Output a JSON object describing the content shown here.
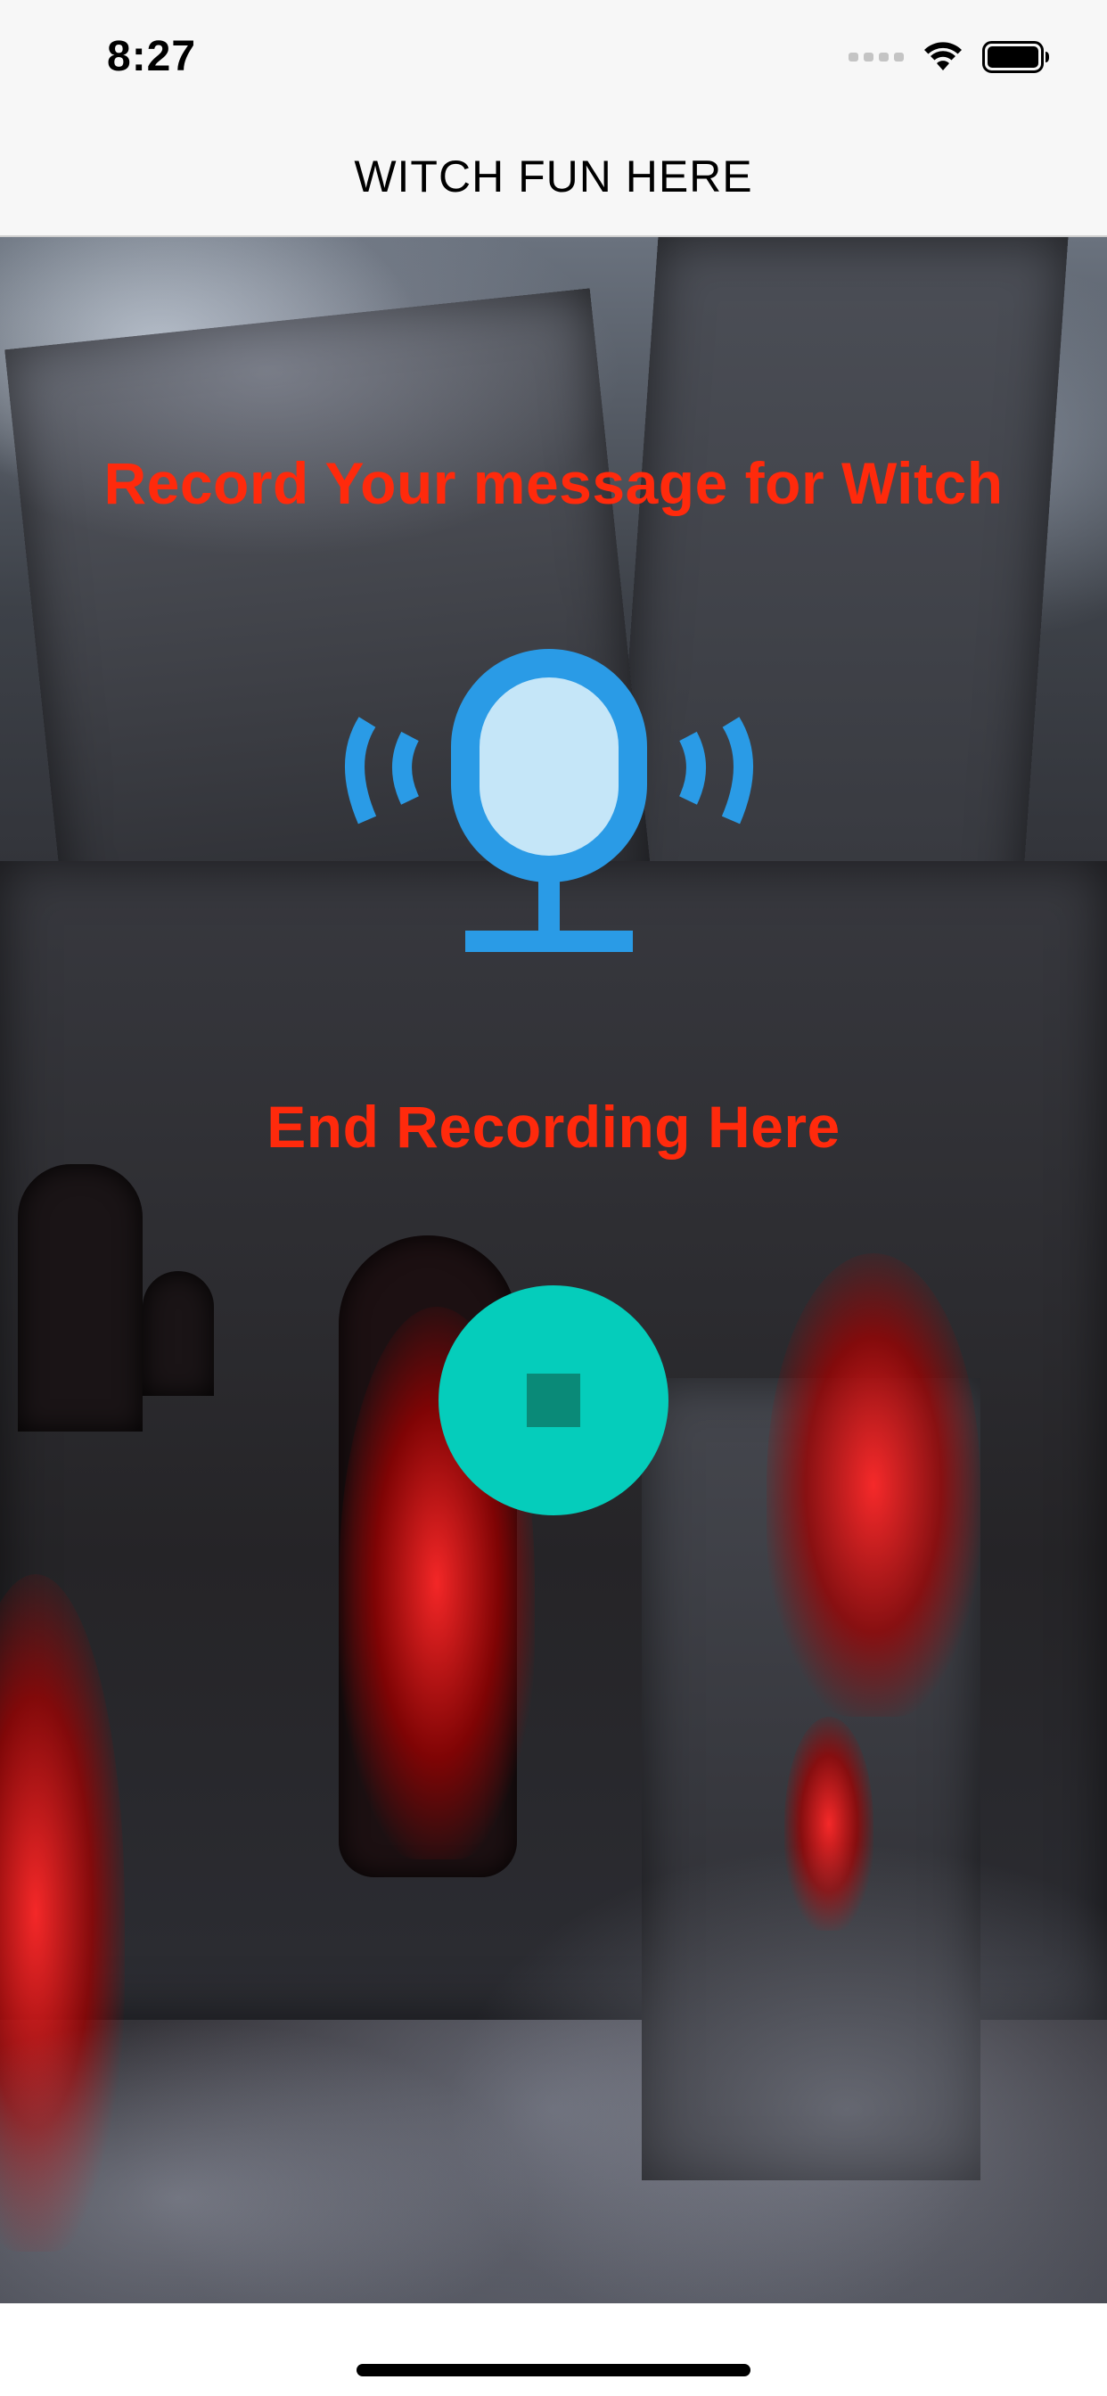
{
  "status_bar": {
    "time": "8:27"
  },
  "nav": {
    "title": "WITCH FUN HERE"
  },
  "main": {
    "record_label": "Record Your message for Witch",
    "end_label": "End Recording Here",
    "background": "haunted-castle-image",
    "mic_icon": "microphone-broadcast-icon",
    "stop_icon": "stop-icon"
  },
  "colors": {
    "label_red": "#ff2a0c",
    "mic_blue": "#2a9be6",
    "mic_light": "#c5e6f8",
    "stop_teal": "#05cdbb",
    "stop_square": "#0a8a78"
  }
}
